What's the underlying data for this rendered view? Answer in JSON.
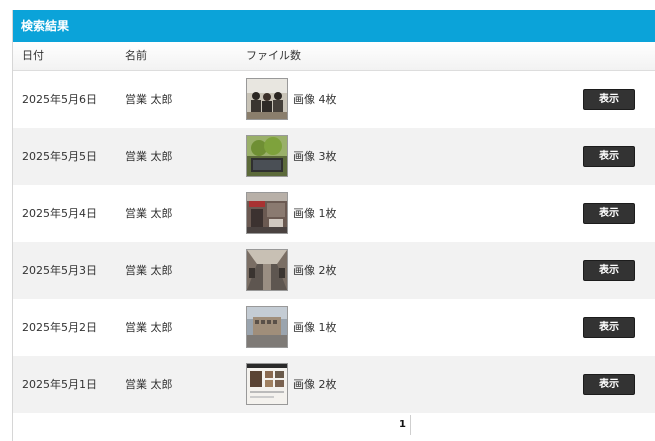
{
  "panel": {
    "title": "検索結果"
  },
  "table": {
    "headers": {
      "date": "日付",
      "name": "名前",
      "files": "ファイル数"
    },
    "rows": [
      {
        "date": "2025年5月6日",
        "name": "営業 太郎",
        "files": "画像 4枚",
        "button": "表示",
        "thumb": "office-group-photo"
      },
      {
        "date": "2025年5月5日",
        "name": "営業 太郎",
        "files": "画像 3枚",
        "button": "表示",
        "thumb": "plant-window-photo"
      },
      {
        "date": "2025年5月4日",
        "name": "営業 太郎",
        "files": "画像 1枚",
        "button": "表示",
        "thumb": "storefront-photo"
      },
      {
        "date": "2025年5月3日",
        "name": "営業 太郎",
        "files": "画像 2枚",
        "button": "表示",
        "thumb": "shopping-arcade-photo"
      },
      {
        "date": "2025年5月2日",
        "name": "営業 太郎",
        "files": "画像 1枚",
        "button": "表示",
        "thumb": "building-street-photo"
      },
      {
        "date": "2025年5月1日",
        "name": "営業 太郎",
        "files": "画像 2枚",
        "button": "表示",
        "thumb": "website-screenshot-photo"
      }
    ]
  },
  "pagination": {
    "current": "1"
  },
  "colors": {
    "header_bg": "#0ba3d9",
    "button_bg": "#333333",
    "alt_row_bg": "#f2f2f2"
  }
}
